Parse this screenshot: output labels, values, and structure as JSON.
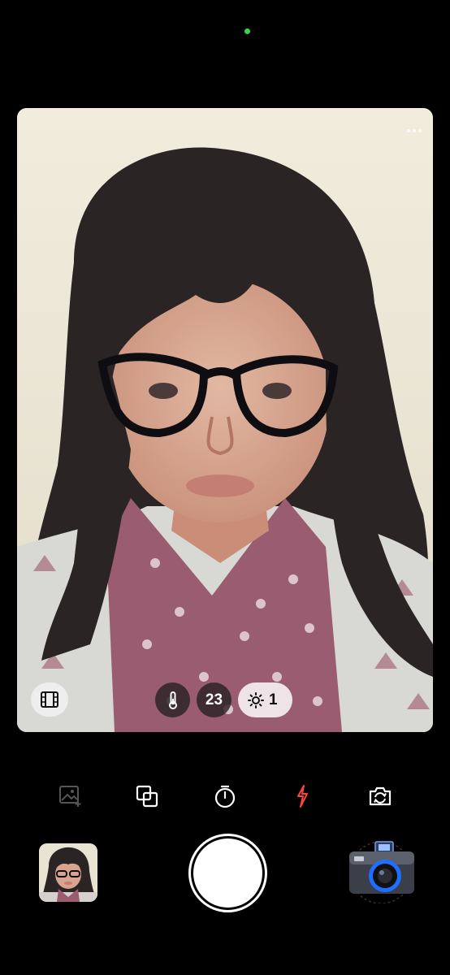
{
  "status_indicator": {
    "color": "#32d74b",
    "icon": "camera-in-use-dot"
  },
  "viewfinder": {
    "more_icon": "more-horizontal-icon",
    "film_icon": "film-strip-icon",
    "chips": {
      "temperature_icon": "thermometer-icon",
      "counter_value": "23",
      "exposure_icon": "brightness-icon",
      "exposure_value": "1"
    }
  },
  "toolbar": {
    "items": [
      {
        "name": "add-photo-icon",
        "enabled": false
      },
      {
        "name": "layers-icon",
        "enabled": true
      },
      {
        "name": "timer-icon",
        "enabled": true
      },
      {
        "name": "flash-icon",
        "enabled": true,
        "color": "#ff453a"
      },
      {
        "name": "flip-camera-icon",
        "enabled": true
      }
    ]
  },
  "bottom": {
    "last_photo": "gallery-thumbnail",
    "shutter": "shutter-button",
    "camera_mode_icon": "vintage-camera-icon",
    "accent_color": "#1e6fff"
  }
}
